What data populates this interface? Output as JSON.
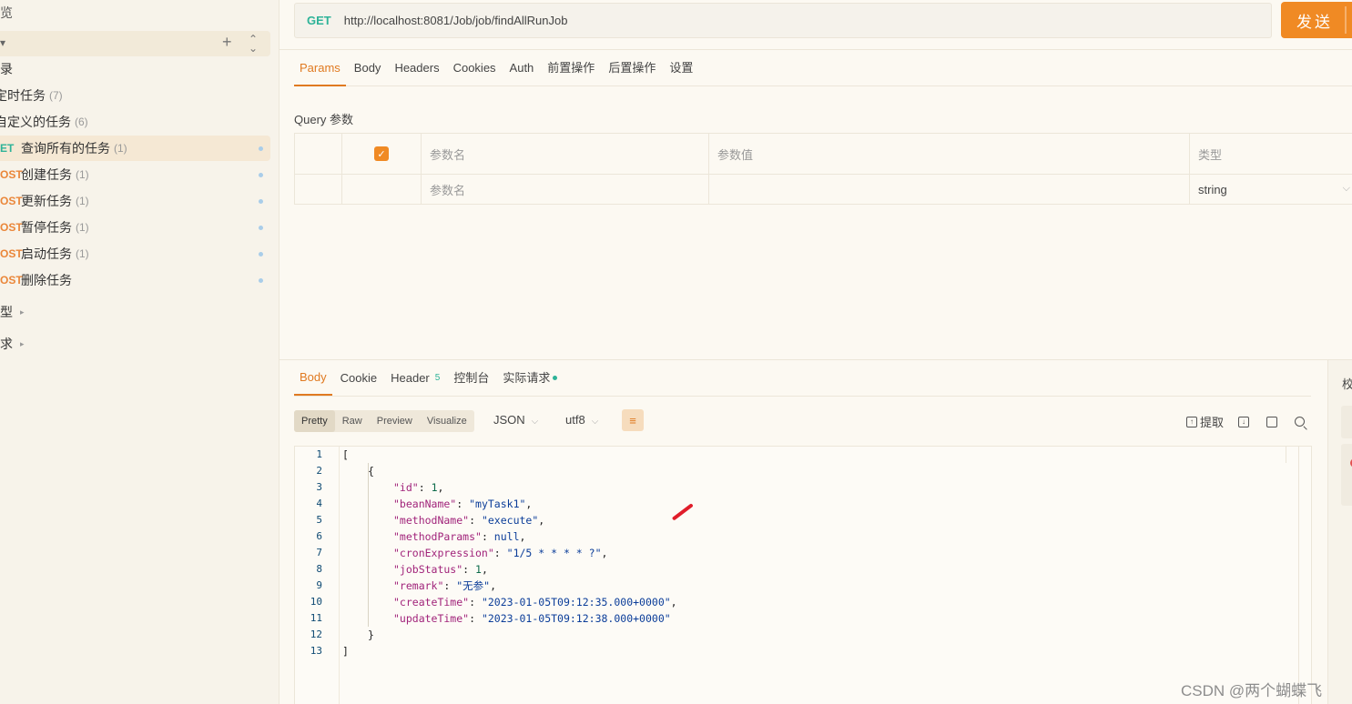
{
  "sidebar": {
    "top_label": "览",
    "add_symbol": "+",
    "sort_symbol": "⌃⌄",
    "items": [
      {
        "method": "",
        "label": "录",
        "count": ""
      },
      {
        "method": "",
        "label": "定时任务",
        "count": "(7)"
      },
      {
        "method": "",
        "label": "自定义的任务",
        "count": "(6)"
      },
      {
        "method": "ET",
        "label": "查询所有的任务",
        "count": "(1)"
      },
      {
        "method": "OST",
        "label": "创建任务",
        "count": "(1)"
      },
      {
        "method": "OST",
        "label": "更新任务",
        "count": "(1)"
      },
      {
        "method": "OST",
        "label": "暂停任务",
        "count": "(1)"
      },
      {
        "method": "OST",
        "label": "启动任务",
        "count": "(1)"
      },
      {
        "method": "OST",
        "label": "删除任务",
        "count": ""
      }
    ],
    "groups": [
      {
        "label": "型"
      },
      {
        "label": "求"
      }
    ]
  },
  "request": {
    "method": "GET",
    "url": "http://localhost:8081/Job/job/findAllRunJob",
    "send_label": "发送",
    "tabs": [
      "Params",
      "Body",
      "Headers",
      "Cookies",
      "Auth",
      "前置操作",
      "后置操作",
      "设置"
    ],
    "active_tab": "Params",
    "query_label": "Query 参数",
    "params_table": {
      "headers": [
        "",
        "",
        "参数名",
        "参数值",
        "类型"
      ],
      "checkbox": "✓",
      "row": {
        "name_placeholder": "参数名",
        "value": "",
        "type": "string"
      }
    }
  },
  "response": {
    "tabs": [
      {
        "label": "Body",
        "badge": ""
      },
      {
        "label": "Cookie",
        "badge": ""
      },
      {
        "label": "Header",
        "badge": "5"
      },
      {
        "label": "控制台",
        "badge": ""
      },
      {
        "label": "实际请求",
        "badge": ""
      }
    ],
    "view_tabs": [
      "Pretty",
      "Raw",
      "Preview",
      "Visualize"
    ],
    "format": "JSON",
    "encoding": "utf8",
    "dropdown_caret": "⌵",
    "wrap_symbol": "≡",
    "tools": {
      "extract_label": "提取"
    },
    "code_lines": [
      "1",
      "2",
      "3",
      "4",
      "5",
      "6",
      "7",
      "8",
      "9",
      "10",
      "11",
      "12",
      "13"
    ],
    "json": {
      "id": "1",
      "beanName": "\"myTask1\"",
      "methodName": "\"execute\"",
      "methodParams": "null",
      "cronExpression": "\"1/5 * * * * ?\"",
      "jobStatus": "1",
      "remark": "\"无参\"",
      "createTime": "\"2023-01-05T09:12:35.000+0000\"",
      "updateTime": "\"2023-01-05T09:12:38.000+0000\""
    }
  },
  "right_panel": {
    "label": "校"
  },
  "watermark": "CSDN @两个蝴蝶飞"
}
